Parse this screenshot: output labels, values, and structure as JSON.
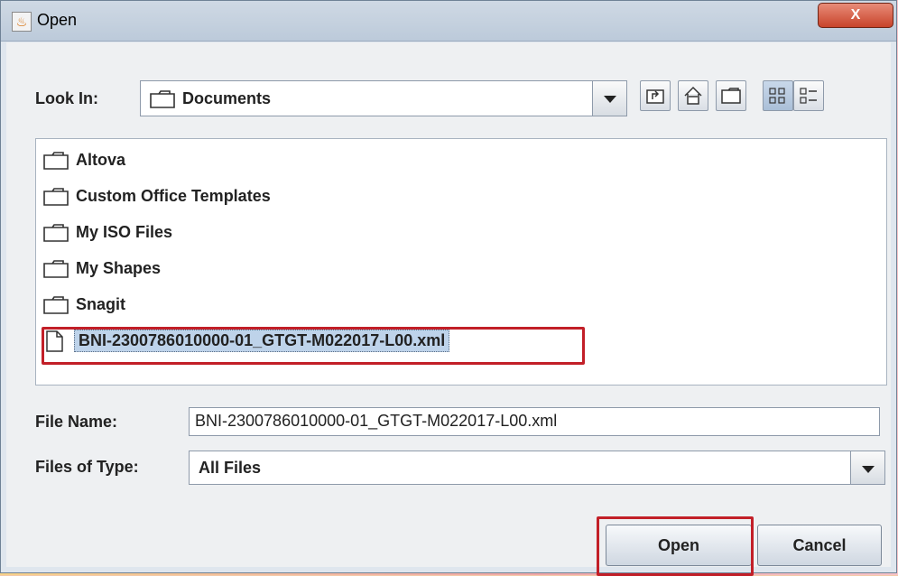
{
  "window": {
    "title": "Open",
    "close_label": "X"
  },
  "look_in": {
    "label": "Look In:",
    "value": "Documents"
  },
  "files": [
    {
      "name": "Altova",
      "type": "folder"
    },
    {
      "name": "Custom Office Templates",
      "type": "folder"
    },
    {
      "name": "My ISO Files",
      "type": "folder"
    },
    {
      "name": "My Shapes",
      "type": "folder"
    },
    {
      "name": "Snagit",
      "type": "folder"
    },
    {
      "name": "BNI-2300786010000-01_GTGT-M022017-L00.xml",
      "type": "file",
      "selected": true
    }
  ],
  "file_name": {
    "label": "File Name:",
    "value": "BNI-2300786010000-01_GTGT-M022017-L00.xml"
  },
  "files_of_type": {
    "label": "Files of Type:",
    "value": "All Files"
  },
  "buttons": {
    "open": "Open",
    "cancel": "Cancel"
  },
  "colors": {
    "highlight": "#c21f28",
    "selection": "#bed3ea"
  }
}
